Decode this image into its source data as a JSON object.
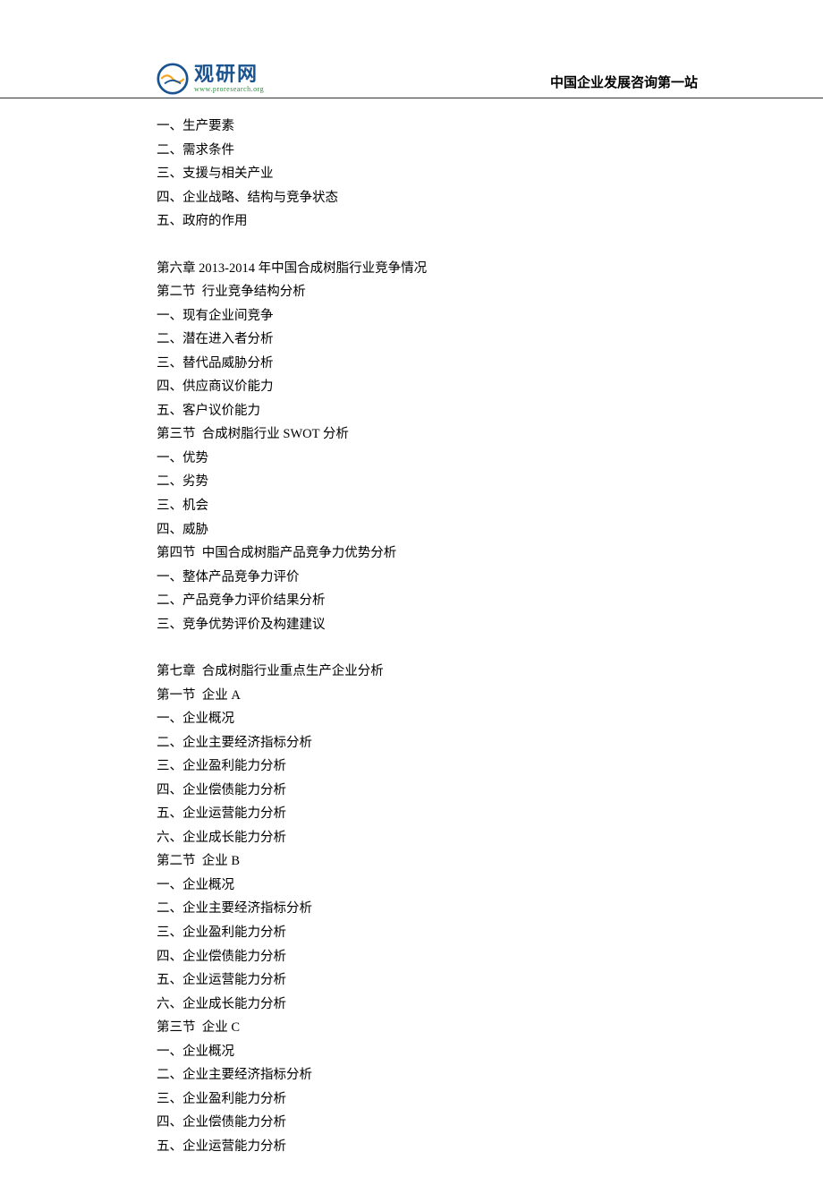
{
  "header": {
    "logo_main": "观研网",
    "logo_sub": "www.proresearch.org",
    "right_text": "中国企业发展咨询第一站"
  },
  "lines": [
    "一、生产要素",
    "二、需求条件",
    "三、支援与相关产业",
    "四、企业战略、结构与竞争状态",
    "五、政府的作用",
    "",
    "第六章 2013-2014 年中国合成树脂行业竞争情况",
    "第二节  行业竞争结构分析",
    "一、现有企业间竞争",
    "二、潜在进入者分析",
    "三、替代品威胁分析",
    "四、供应商议价能力",
    "五、客户议价能力",
    "第三节  合成树脂行业 SWOT 分析",
    "一、优势",
    "二、劣势",
    "三、机会",
    "四、威胁",
    "第四节  中国合成树脂产品竞争力优势分析",
    "一、整体产品竞争力评价",
    "二、产品竞争力评价结果分析",
    "三、竞争优势评价及构建建议",
    "",
    "第七章  合成树脂行业重点生产企业分析",
    "第一节  企业 A",
    "一、企业概况",
    "二、企业主要经济指标分析",
    "三、企业盈利能力分析",
    "四、企业偿债能力分析",
    "五、企业运营能力分析",
    "六、企业成长能力分析",
    "第二节  企业 B",
    "一、企业概况",
    "二、企业主要经济指标分析",
    "三、企业盈利能力分析",
    "四、企业偿债能力分析",
    "五、企业运营能力分析",
    "六、企业成长能力分析",
    "第三节  企业 C",
    "一、企业概况",
    "二、企业主要经济指标分析",
    "三、企业盈利能力分析",
    "四、企业偿债能力分析",
    "五、企业运营能力分析"
  ]
}
